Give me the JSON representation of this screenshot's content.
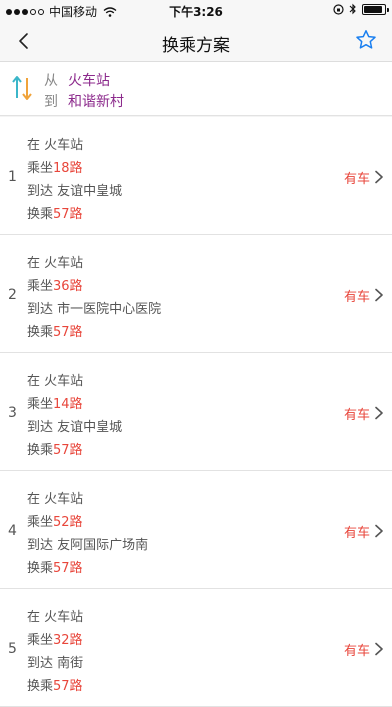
{
  "status_bar": {
    "carrier": "中国移动",
    "time": "下午3:26",
    "battery_level": 0.9
  },
  "nav": {
    "title": "换乘方案"
  },
  "route": {
    "from_label": "从",
    "from": "火车站",
    "to_label": "到",
    "to": "和谐新村"
  },
  "labels": {
    "at": "在",
    "take": "乘坐",
    "arrive": "到达",
    "transfer": "换乘",
    "available": "有车"
  },
  "plans": [
    {
      "index": "1",
      "start": "火车站",
      "bus": "18路",
      "arrive": "友谊中皇城",
      "transfer": "57路"
    },
    {
      "index": "2",
      "start": "火车站",
      "bus": "36路",
      "arrive": "市一医院中心医院",
      "transfer": "57路"
    },
    {
      "index": "3",
      "start": "火车站",
      "bus": "14路",
      "arrive": "友谊中皇城",
      "transfer": "57路"
    },
    {
      "index": "4",
      "start": "火车站",
      "bus": "52路",
      "arrive": "友阿国际广场南",
      "transfer": "57路"
    },
    {
      "index": "5",
      "start": "火车站",
      "bus": "32路",
      "arrive": "南街",
      "transfer": "57路"
    }
  ],
  "colors": {
    "accent_red": "#e8463b",
    "place_purple": "#8c2a8c",
    "nav_blue": "#1a7ff0"
  }
}
